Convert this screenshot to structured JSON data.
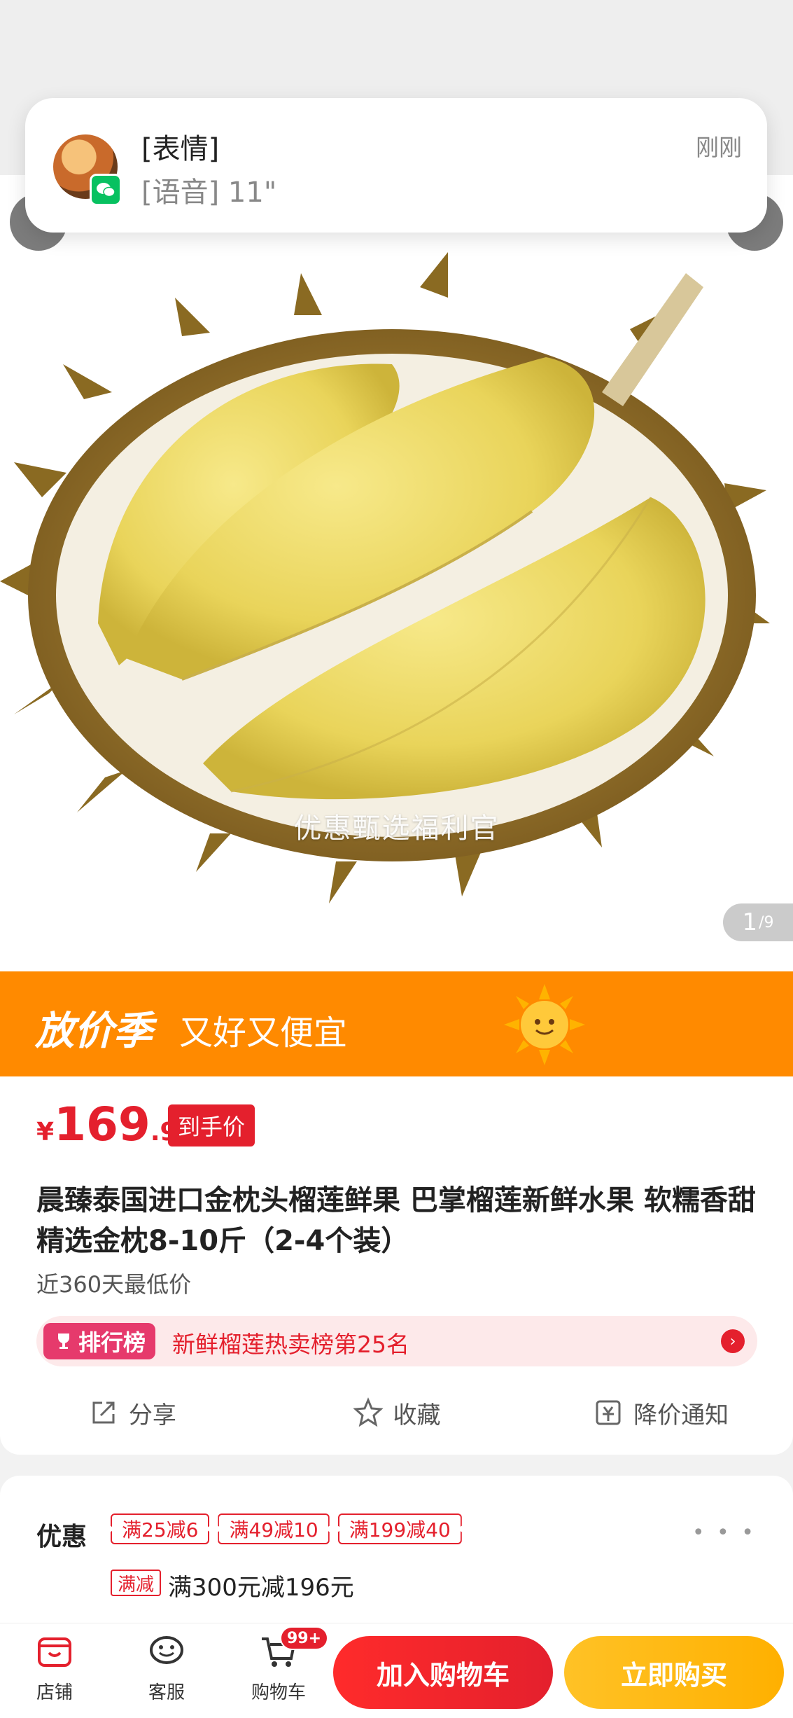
{
  "notification": {
    "title": "[表情]",
    "message": "[语音] 11\"",
    "time": "刚刚"
  },
  "hero": {
    "watermark": "优惠甄选福利官",
    "counter_current": "1",
    "counter_total": "/9"
  },
  "promo": {
    "brand": "放价季",
    "slogan": "又好又便宜"
  },
  "product": {
    "price_currency": "¥",
    "price_int": "169",
    "price_dec": ".90",
    "price_tag": "到手价",
    "title": "晨臻泰国进口金枕头榴莲鲜果 巴掌榴莲新鲜水果 软糯香甜 精选金枕8-10斤（2-4个装）",
    "lowest_price_note": "近360天最低价",
    "rank_badge": "排行榜",
    "rank_text": "新鲜榴莲热卖榜第25名"
  },
  "actions": {
    "share": "分享",
    "favorite": "收藏",
    "price_alert": "降价通知"
  },
  "discounts": {
    "label": "优惠",
    "coupons": [
      "满25减6",
      "满49减10",
      "满199减40"
    ],
    "rule_tag": "满减",
    "rule_text": "满300元减196元"
  },
  "bottom_bar": {
    "shop": "店铺",
    "service": "客服",
    "cart": "购物车",
    "cart_badge": "99+",
    "add_to_cart": "加入购物车",
    "buy_now": "立即购买"
  },
  "colors": {
    "accent_red": "#e4202d",
    "promo_orange": "#ff8a00",
    "buy_yellow": "#ffb000",
    "wechat_green": "#07c160"
  }
}
